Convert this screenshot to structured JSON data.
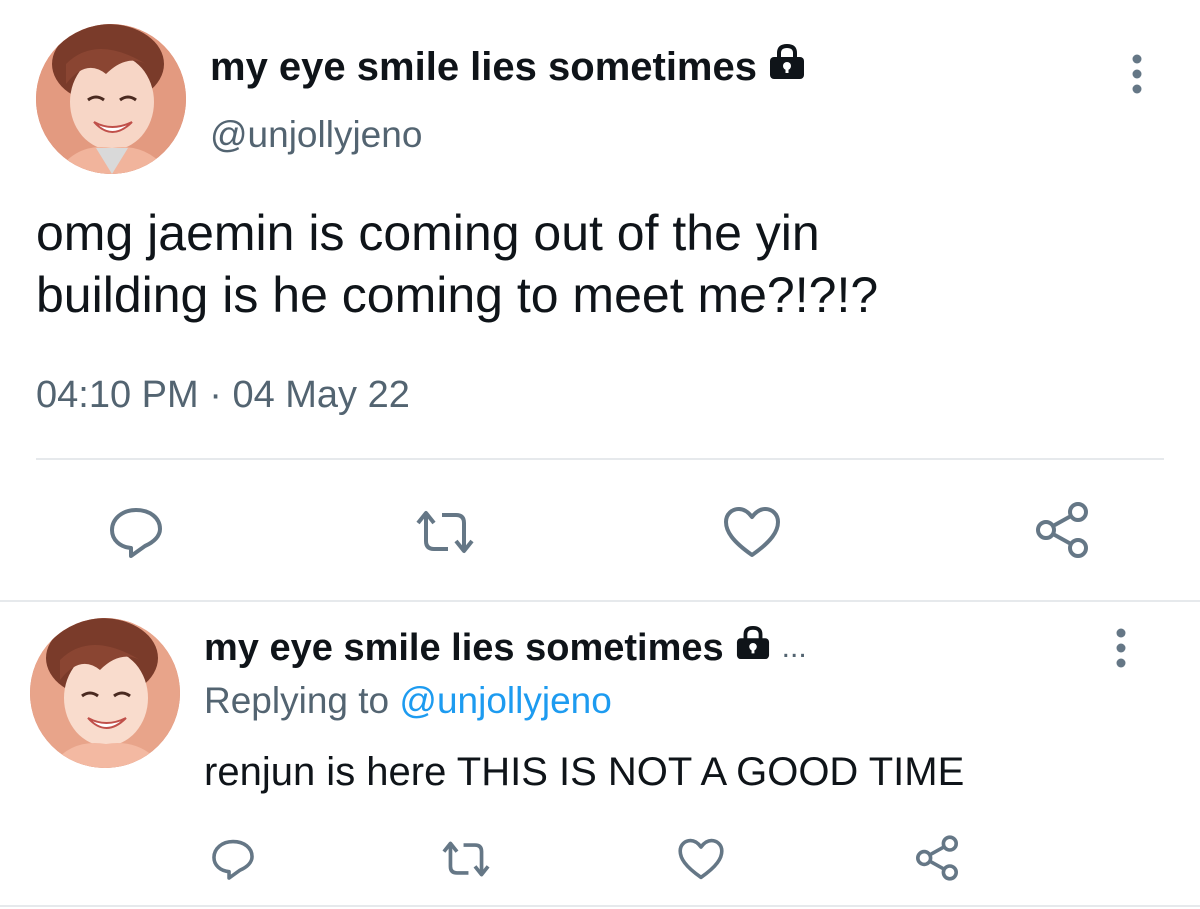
{
  "main_tweet": {
    "display_name": "my eye smile lies sometimes",
    "handle": "@unjollyjeno",
    "text_line_1": "omg jaemin is coming out of the yin",
    "text_line_2": "building is he coming to meet me?!?!?",
    "time": "04:10 PM",
    "separator": "·",
    "date": "04 May 22",
    "avatar_icon": "user-avatar-photo",
    "lock_icon": "lock-icon",
    "more_icon": "more-vertical-icon",
    "actions": [
      "reply-icon",
      "retweet-icon",
      "like-icon",
      "share-icon"
    ]
  },
  "reply_tweet": {
    "display_name": "my eye smile lies sometimes",
    "ellipsis": "...",
    "replying_prefix": "Replying to ",
    "replying_handle": "@unjollyjeno",
    "text": "renjun is here THIS IS NOT A GOOD TIME",
    "avatar_icon": "user-avatar-photo",
    "lock_icon": "lock-icon",
    "more_icon": "more-vertical-icon",
    "actions": [
      "reply-icon",
      "retweet-icon",
      "like-icon",
      "share-icon"
    ]
  },
  "colors": {
    "text_primary": "#0f1419",
    "text_secondary": "#536471",
    "icon_gray": "#657786",
    "link_blue": "#1d9bf0",
    "divider": "#e6e9ec"
  }
}
